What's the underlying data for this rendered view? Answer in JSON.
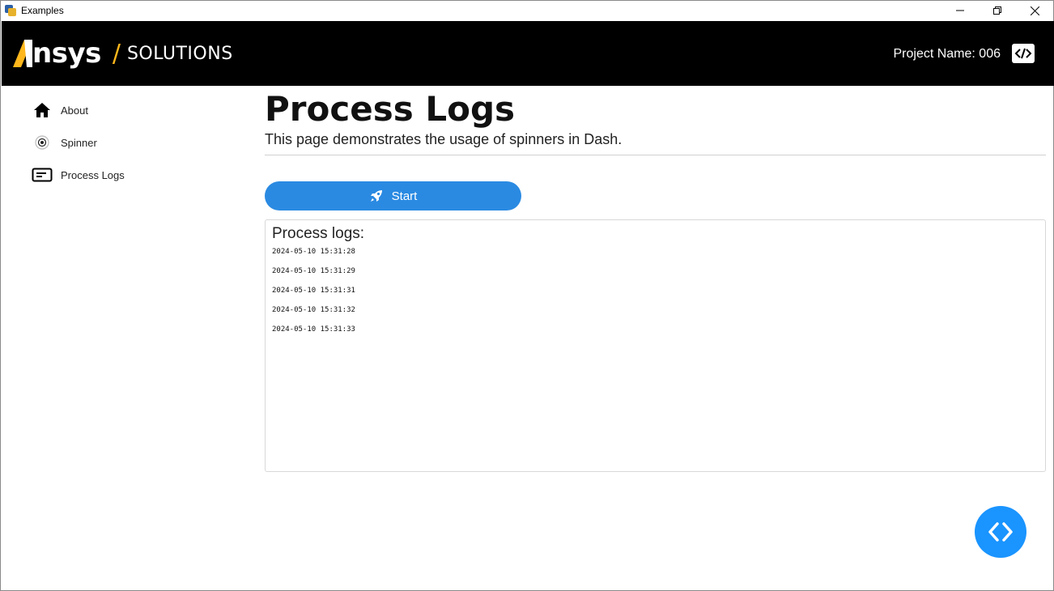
{
  "window": {
    "title": "Examples"
  },
  "header": {
    "logo_text": "nsys",
    "logo_separator": "/",
    "logo_suffix": "SOLUTIONS",
    "project_label": "Project Name: 006",
    "accent_color": "#ffb71b"
  },
  "sidebar": {
    "items": [
      {
        "label": "About",
        "icon": "home-icon"
      },
      {
        "label": "Spinner",
        "icon": "target-icon"
      },
      {
        "label": "Process Logs",
        "icon": "logs-icon"
      }
    ]
  },
  "main": {
    "title": "Process Logs",
    "subtitle": "This page demonstrates the usage of spinners in Dash.",
    "start_button": {
      "label": "Start",
      "icon": "rocket-icon",
      "color": "#2a8ae2"
    },
    "logs": {
      "title": "Process logs:",
      "lines": [
        "2024-05-10 15:31:28",
        "2024-05-10 15:31:29",
        "2024-05-10 15:31:31",
        "2024-05-10 15:31:32",
        "2024-05-10 15:31:33"
      ]
    }
  },
  "fab": {
    "icon": "code-icon",
    "color": "#1a94ff"
  }
}
